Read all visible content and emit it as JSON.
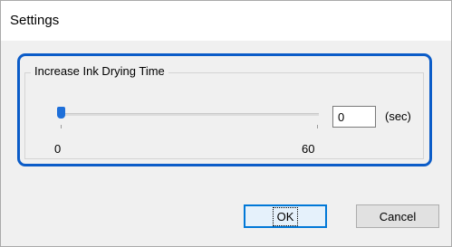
{
  "window": {
    "title": "Settings"
  },
  "group": {
    "label": "Increase Ink Drying Time",
    "slider": {
      "min_label": "0",
      "max_label": "60",
      "value": 0,
      "min": 0,
      "max": 60
    },
    "input_value": "0",
    "unit": "(sec)"
  },
  "buttons": {
    "ok": "OK",
    "cancel": "Cancel"
  },
  "colors": {
    "highlight": "#0b5cc8",
    "slider_thumb": "#1e6fd9",
    "ok_border": "#0078d7"
  }
}
